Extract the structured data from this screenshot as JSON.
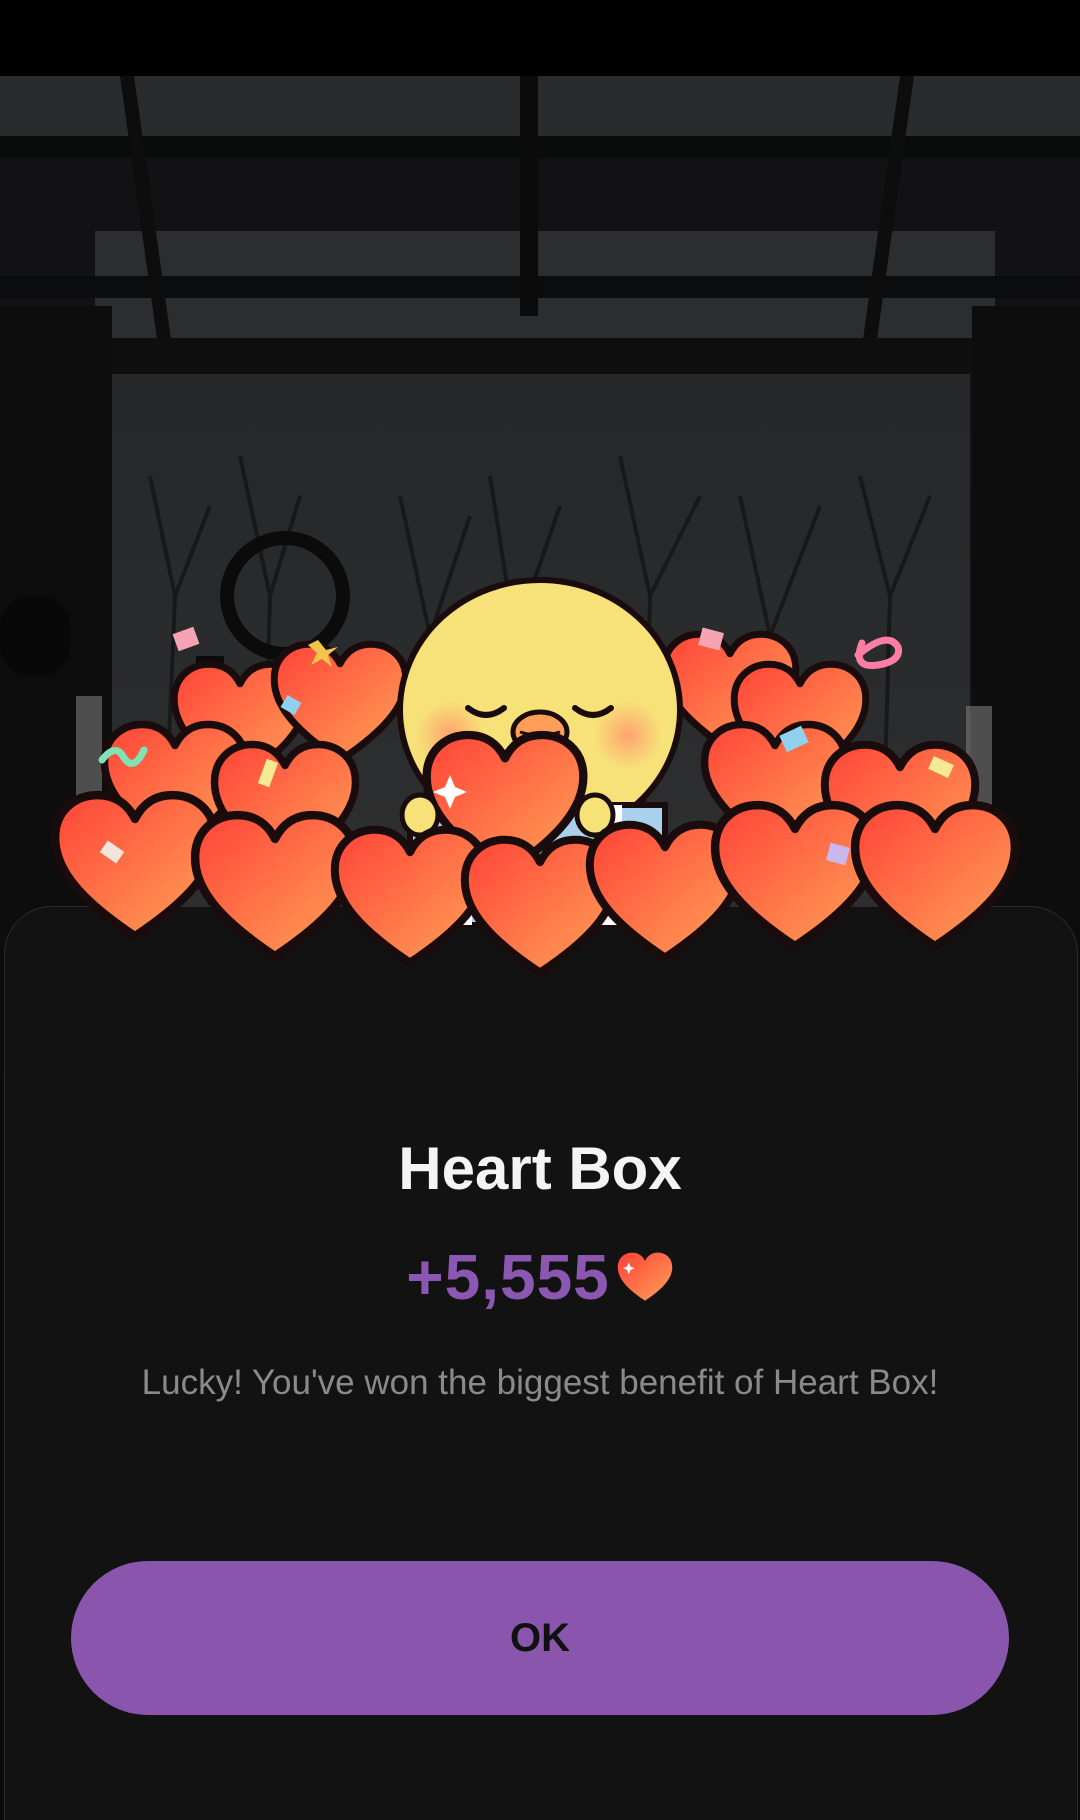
{
  "dialog": {
    "title": "Heart Box",
    "reward_amount": "+5,555",
    "reward_icon": "heart-icon",
    "message": "Lucky! You've won the biggest benefit of Heart Box!",
    "ok_label": "OK"
  },
  "illustration": {
    "character": "yellow-chick-holding-heart",
    "items": "hearts-pile",
    "effects": "confetti"
  },
  "colors": {
    "accent": "#8a56ad",
    "reward_text": "#8b57b0",
    "sheet_background": "#121212",
    "title_text": "#f4f4f4",
    "message_text": "#8a8a8a",
    "heart": "#ff5a3c"
  }
}
